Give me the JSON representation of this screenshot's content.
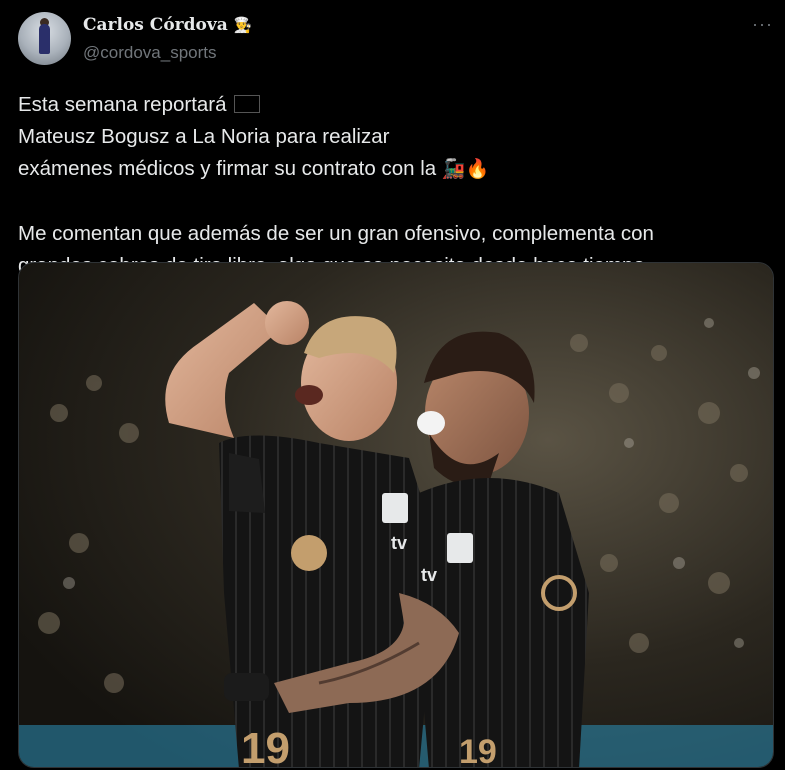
{
  "author": {
    "name": "Carlos Córdova",
    "name_emoji": "👨‍🍳",
    "handle": "@cordova_sports"
  },
  "more_icon": "more-horizontal-icon",
  "tweet": {
    "line1_a": "Esta semana reportará",
    "line1_b": "Mateusz Bogusz a La Noria para realizar",
    "line2_a": "exámenes médicos y firmar su contrato con la",
    "line2_emoji_1": "🚂",
    "line2_emoji_2": "🔥",
    "para2_line1": "Me comentan que además de ser un gran ofensivo, complementa con",
    "para2_line2": "grandes cobros de tiro libre, algo que se necesita desde hace tiempo."
  },
  "flag_icon": "poland-flag-icon",
  "jersey": {
    "sponsor": "tv",
    "number": "19"
  },
  "colors": {
    "background": "#000000",
    "text": "#e7e9ea",
    "muted": "#71767b",
    "jersey_gold": "#c39e6d"
  }
}
